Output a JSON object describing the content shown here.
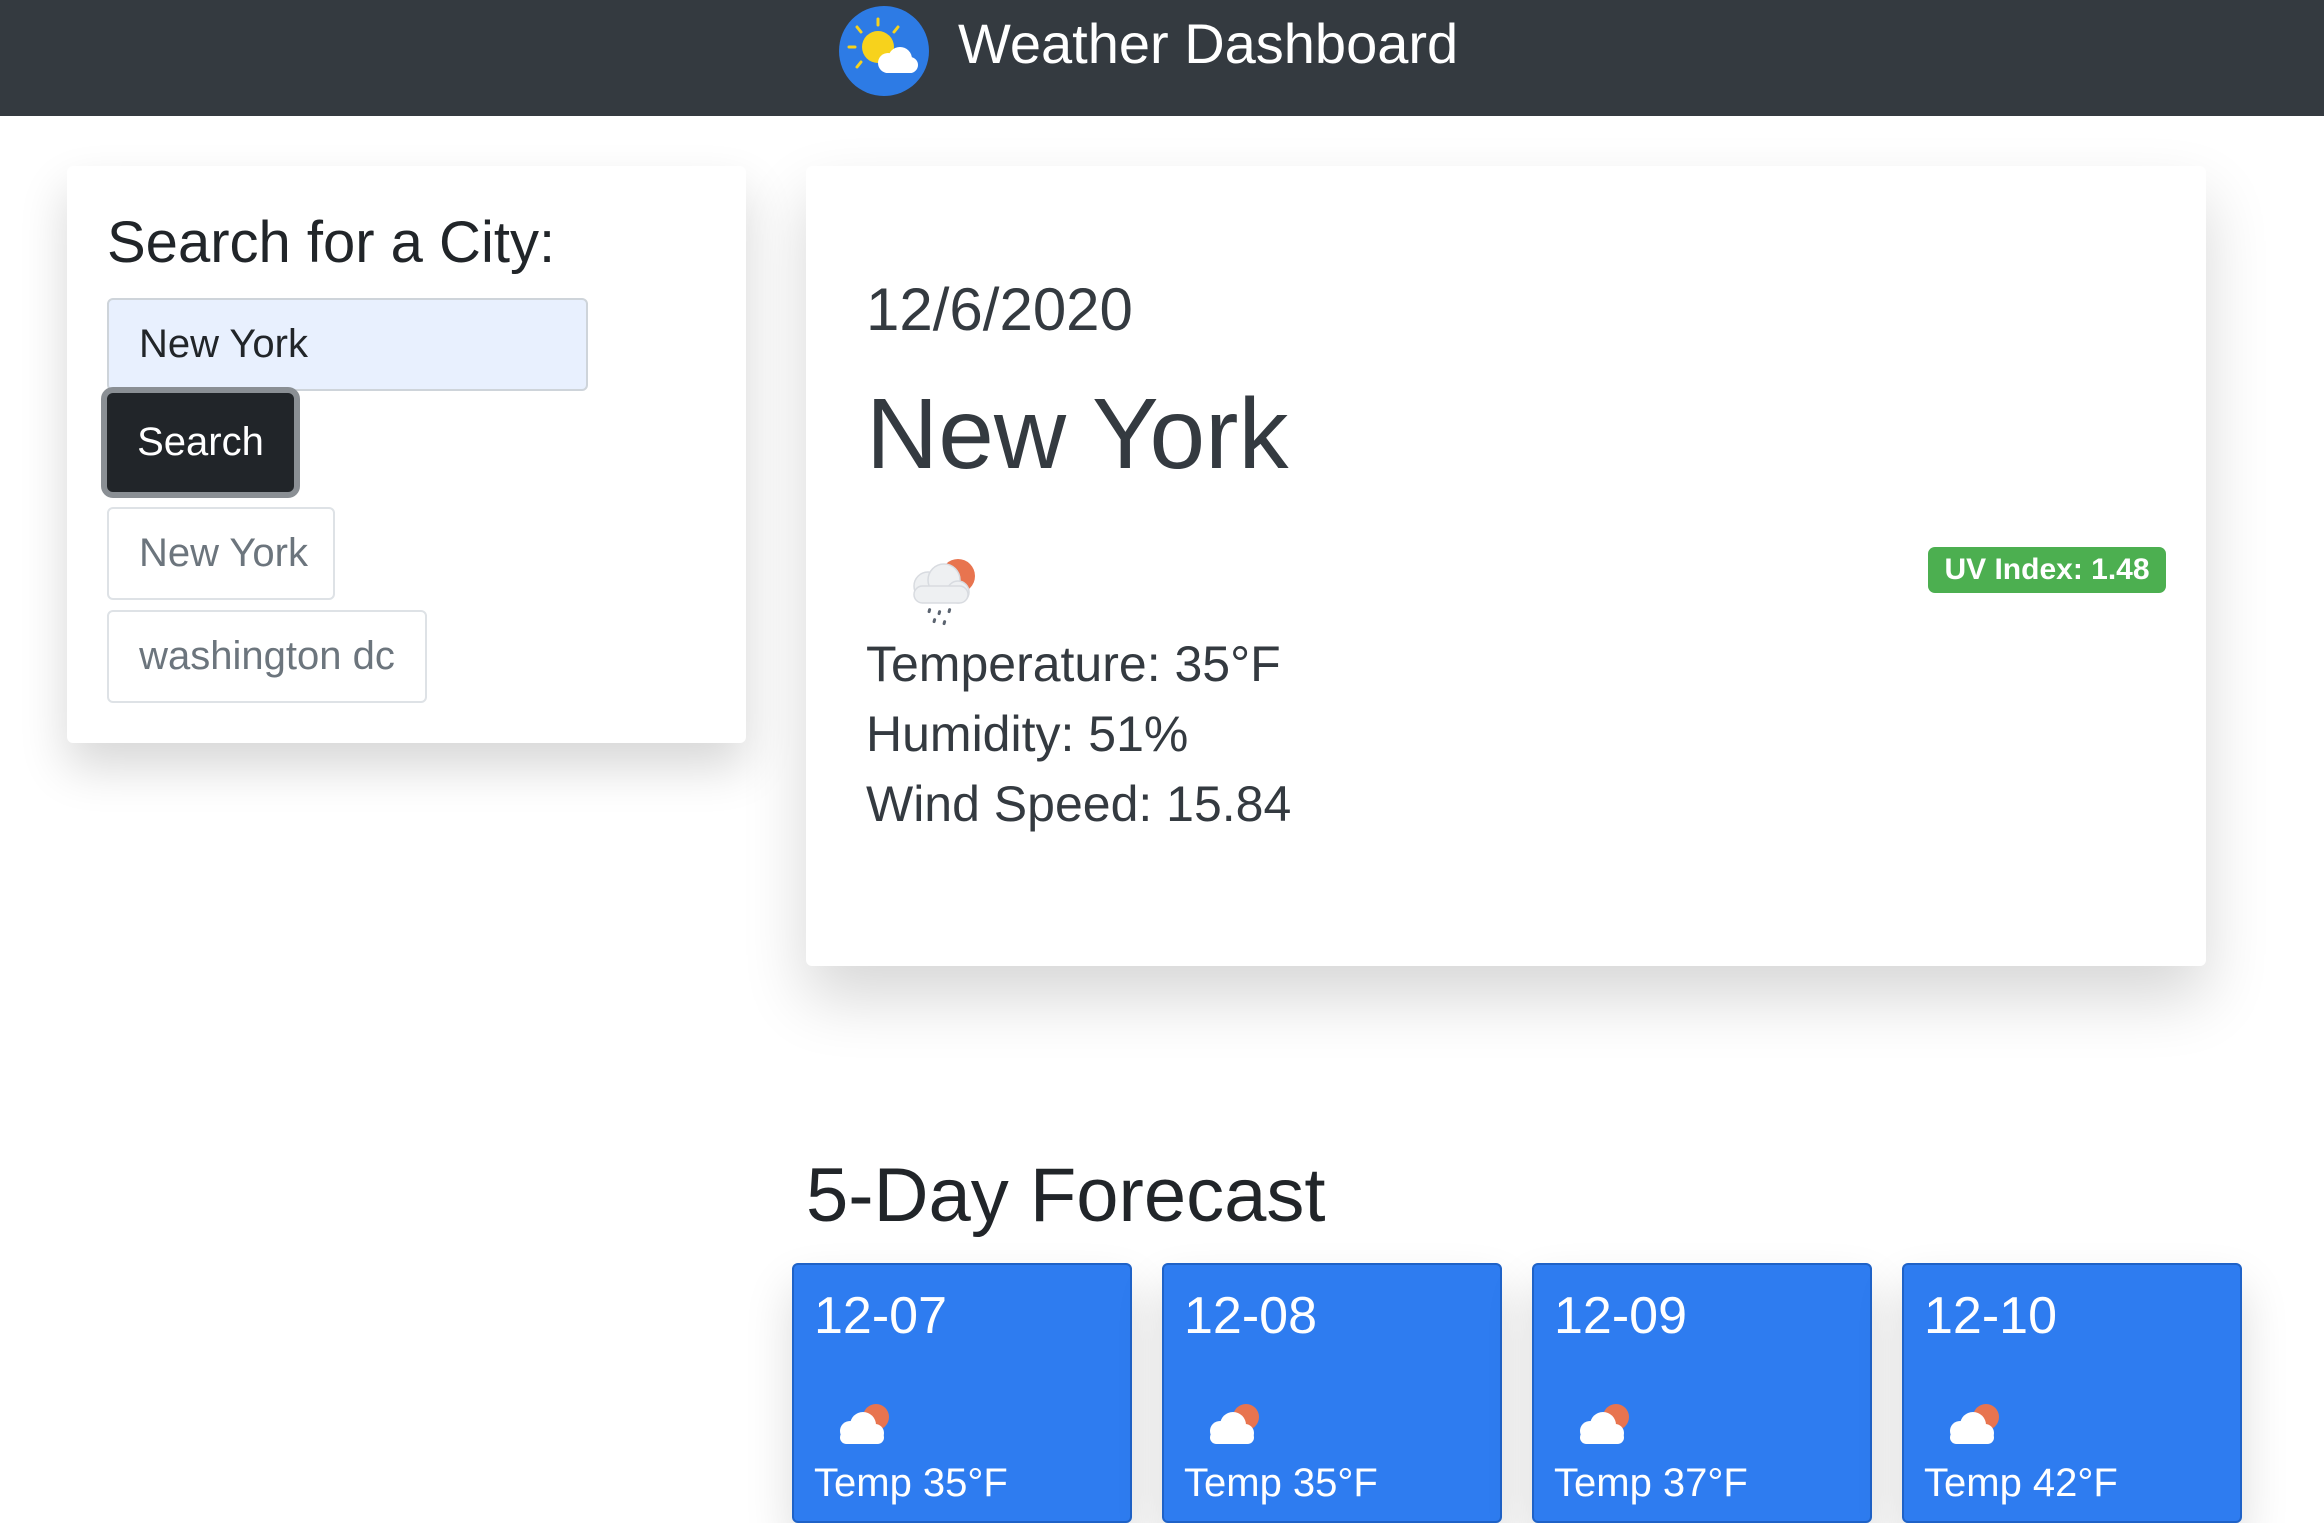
{
  "header": {
    "title": "Weather Dashboard",
    "logo_icon": "sun-cloud-icon"
  },
  "search": {
    "title": "Search for a City:",
    "input_value": "New York",
    "button_label": "Search",
    "history": [
      "New York",
      "washington dc"
    ]
  },
  "current": {
    "date": "12/6/2020",
    "city": "New York",
    "icon": "rain-cloud-sun-icon",
    "uv_label": "UV Index: 1.48",
    "temperature": "Temperature: 35°F",
    "humidity": "Humidity: 51%",
    "wind": "Wind Speed: 15.84"
  },
  "forecast": {
    "title": "5-Day Forecast",
    "days": [
      {
        "date": "12-07",
        "icon": "cloud-sun-icon",
        "temp": "Temp 35°F"
      },
      {
        "date": "12-08",
        "icon": "cloud-sun-icon",
        "temp": "Temp 35°F"
      },
      {
        "date": "12-09",
        "icon": "cloud-sun-icon",
        "temp": "Temp 37°F"
      },
      {
        "date": "12-10",
        "icon": "cloud-sun-icon",
        "temp": "Temp 42°F"
      }
    ]
  },
  "colors": {
    "navbar": "#343a40",
    "forecast_card": "#2e7cf0",
    "uv_badge": "#4caf50",
    "search_button": "#212529"
  }
}
